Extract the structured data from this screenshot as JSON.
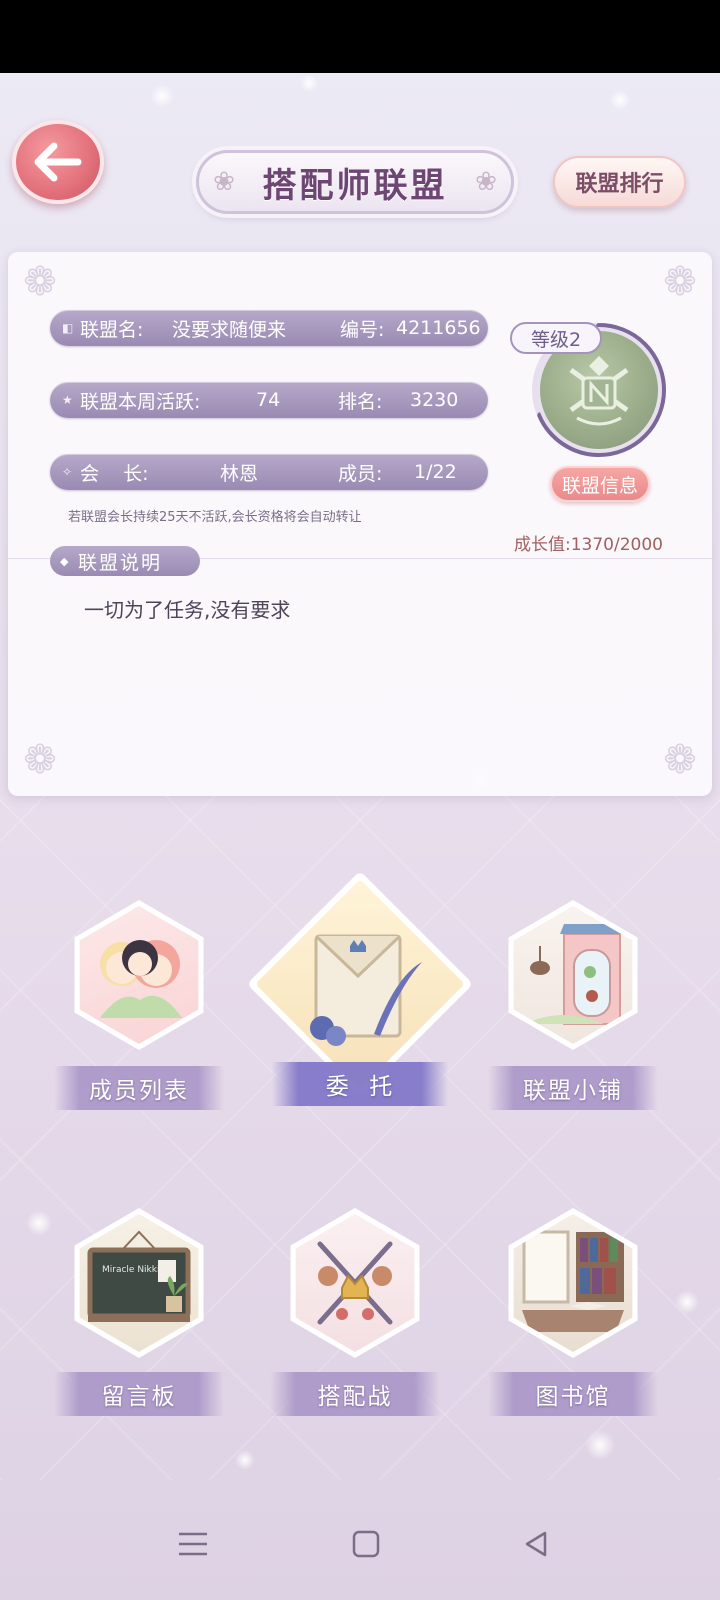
{
  "header": {
    "title": "搭配师联盟",
    "rank_button": "联盟排行"
  },
  "alliance": {
    "name_label": "联盟名:",
    "name_value": "没要求随便来",
    "id_label": "编号:",
    "id_value": "4211656",
    "activity_label": "联盟本周活跃:",
    "activity_value": "74",
    "rank_label": "排名:",
    "rank_value": "3230",
    "leader_label": "会    长:",
    "leader_value": "林恩",
    "members_label": "成员:",
    "members_value": "1/22",
    "level": "等级2",
    "info_button": "联盟信息",
    "notice": "若联盟会长持续25天不活跃,会长资格将会自动转让",
    "growth": "成长值:1370/2000",
    "growth_progress": 0.685,
    "description_title": "联盟说明",
    "description": "一切为了任务,没有要求"
  },
  "features": [
    {
      "label": "成员列表",
      "icon": "members-icon"
    },
    {
      "label": "委  托",
      "icon": "commission-icon"
    },
    {
      "label": "联盟小铺",
      "icon": "shop-icon"
    },
    {
      "label": "留言板",
      "icon": "message-board-icon"
    },
    {
      "label": "搭配战",
      "icon": "battle-icon"
    },
    {
      "label": "图书馆",
      "icon": "library-icon"
    }
  ],
  "chalkboard_text": "Miracle Nikki",
  "colors": {
    "back_button": "#e2707a",
    "pill": "#9a8ab3",
    "accent_pink": "#e98a8b",
    "title": "#6e4673"
  }
}
